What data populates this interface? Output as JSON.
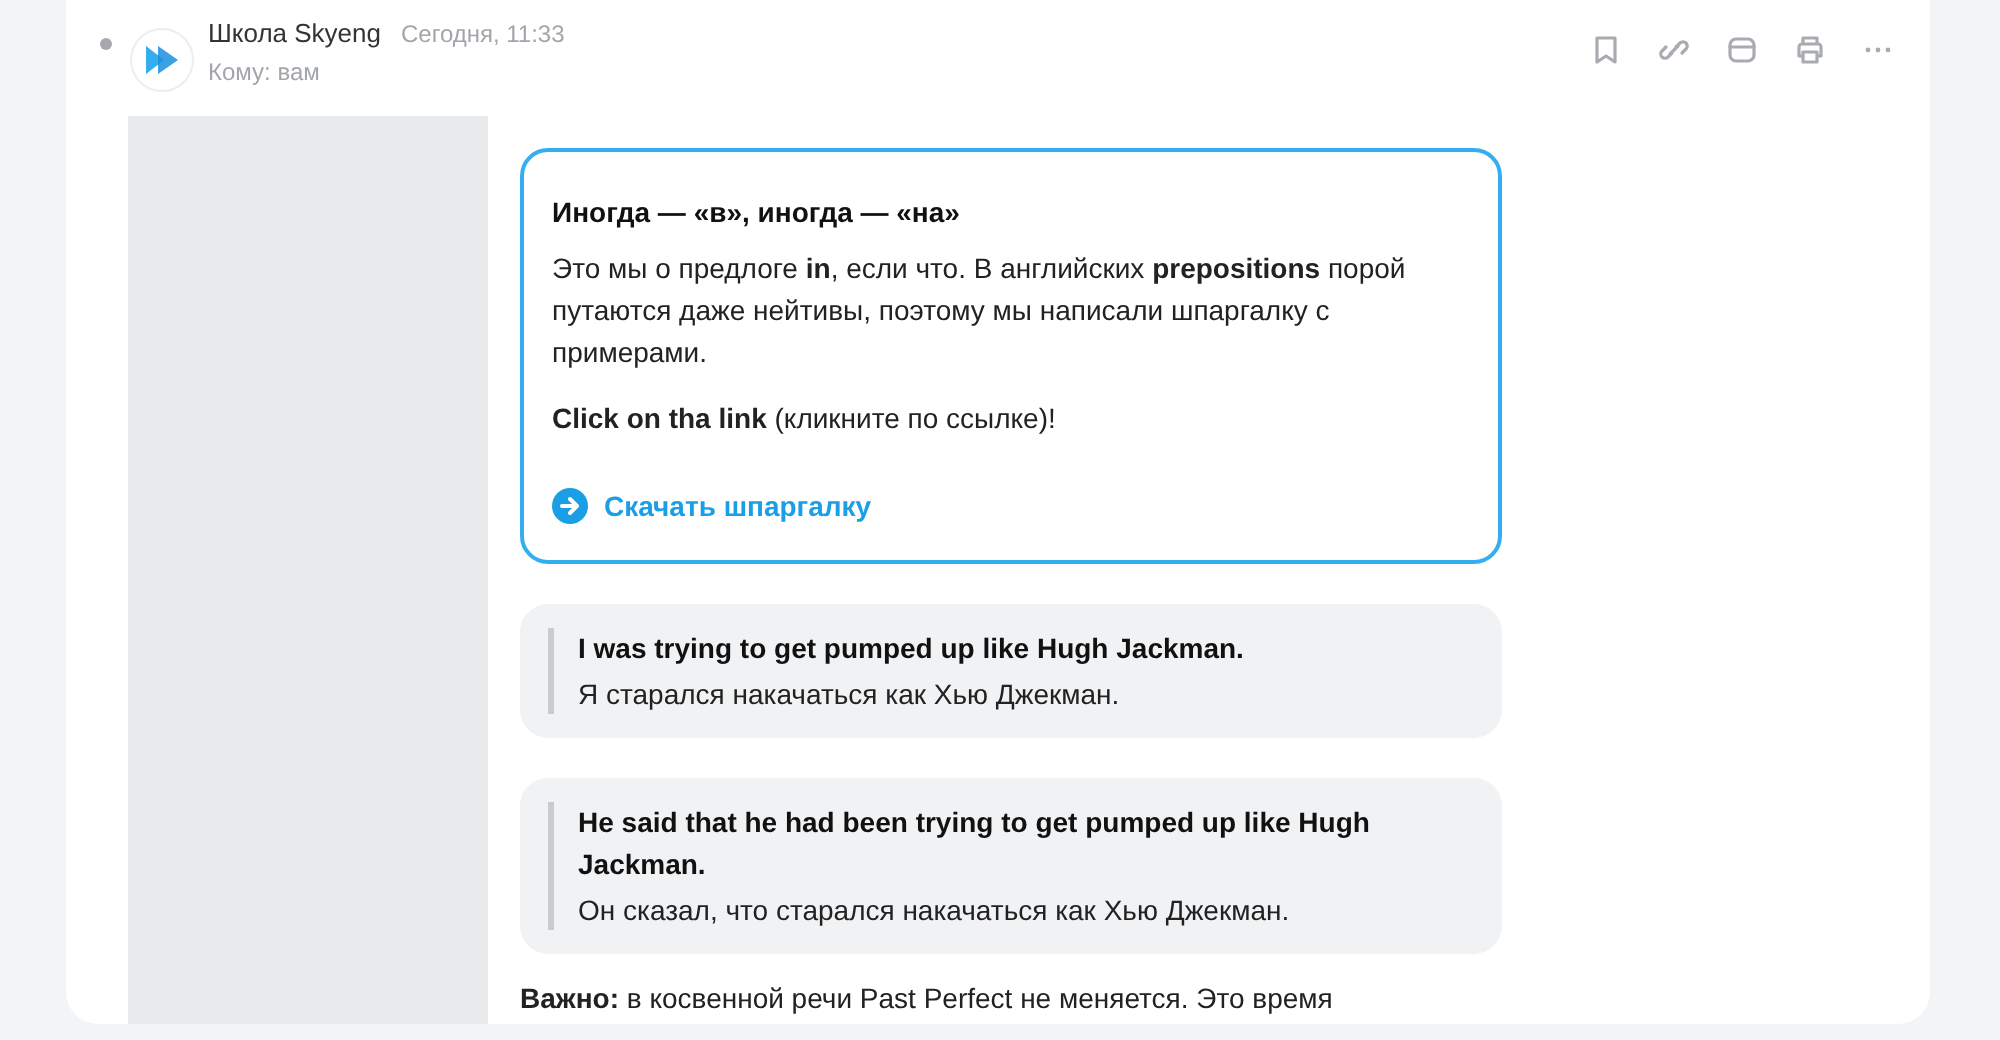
{
  "header": {
    "sender": "Школа Skyeng",
    "time": "Сегодня, 11:33",
    "recipient": "Кому: вам",
    "unread": true
  },
  "toolbar": [
    {
      "kind": "bookmark"
    },
    {
      "kind": "link"
    },
    {
      "kind": "calendar"
    },
    {
      "kind": "print"
    },
    {
      "kind": "more"
    }
  ],
  "card": {
    "title": "Иногда — «в», иногда — «на»",
    "body": "Это мы о предлоге **in**, если что. В английских **prepositions** порой путаются даже нейтивы, поэтому мы написали шпаргалку с примерами.",
    "prompt": "**Click on tha link** (кликните по ссылке)!",
    "link": "Скачать шпаргалку"
  },
  "quotes": [
    {
      "english": "I was trying to get pumped up like Hugh Jackman.",
      "russian": "Я старался накачаться как Хью Джекман."
    },
    {
      "english": "He said that he had been trying to get pumped up like Hugh Jackman.",
      "russian": "Он сказал, что старался накачаться как Хью Джекман."
    }
  ],
  "note": "**Важно:** в косвенной речи Past Perfect не меняется. Это время"
}
